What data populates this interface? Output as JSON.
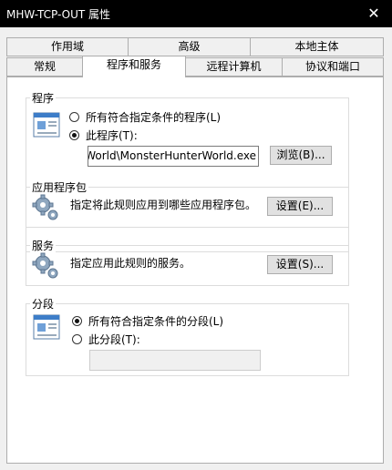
{
  "window": {
    "title": "MHW-TCP-OUT 属性",
    "close_symbol": "✕"
  },
  "tabs": {
    "row_top": [
      {
        "label": "作用域"
      },
      {
        "label": "高级"
      },
      {
        "label": "本地主体"
      }
    ],
    "row_bottom": [
      {
        "label": "常规"
      },
      {
        "label": "程序和服务"
      },
      {
        "label": "远程计算机"
      },
      {
        "label": "协议和端口"
      }
    ],
    "active": "程序和服务"
  },
  "programs": {
    "legend": "程序",
    "option_all": "所有符合指定条件的程序(L)",
    "option_this": "此程序(T):",
    "selected": "this",
    "path_value": "C:\\Games\\Monster Hunter World\\MonsterHunterWorld.exe",
    "browse_label": "浏览(B)..."
  },
  "app_packages": {
    "legend": "应用程序包",
    "description": "指定将此规则应用到哪些应用程序包。",
    "settings_label": "设置(E)..."
  },
  "services": {
    "legend": "服务",
    "description": "指定应用此规则的服务。",
    "settings_label": "设置(S)..."
  },
  "segments": {
    "legend": "分段",
    "option_all": "所有符合指定条件的分段(L)",
    "option_this": "此分段(T):",
    "selected": "all",
    "value": ""
  }
}
